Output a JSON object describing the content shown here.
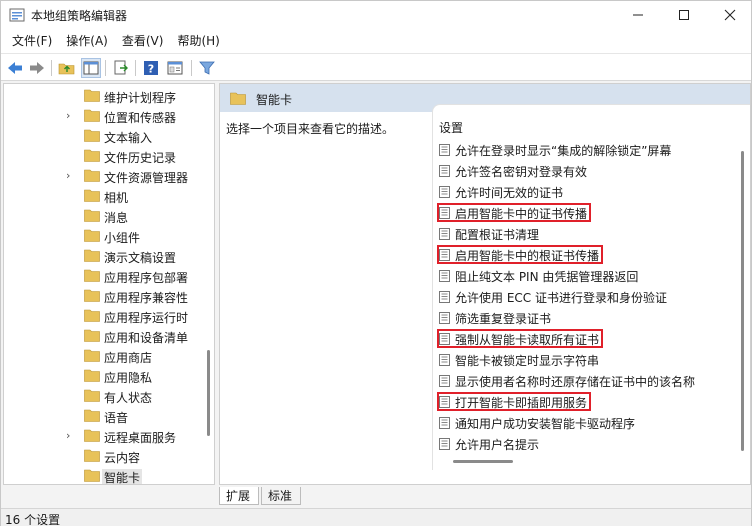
{
  "window": {
    "title": "本地组策略编辑器"
  },
  "menu": [
    "文件(F)",
    "操作(A)",
    "查看(V)",
    "帮助(H)"
  ],
  "tree": {
    "items": [
      {
        "label": "维护计划程序",
        "expandable": false,
        "selected": false
      },
      {
        "label": "位置和传感器",
        "expandable": true,
        "selected": false
      },
      {
        "label": "文本输入",
        "expandable": false,
        "selected": false
      },
      {
        "label": "文件历史记录",
        "expandable": false,
        "selected": false
      },
      {
        "label": "文件资源管理器",
        "expandable": true,
        "selected": false
      },
      {
        "label": "相机",
        "expandable": false,
        "selected": false
      },
      {
        "label": "消息",
        "expandable": false,
        "selected": false
      },
      {
        "label": "小组件",
        "expandable": false,
        "selected": false
      },
      {
        "label": "演示文稿设置",
        "expandable": false,
        "selected": false
      },
      {
        "label": "应用程序包部署",
        "expandable": false,
        "selected": false
      },
      {
        "label": "应用程序兼容性",
        "expandable": false,
        "selected": false
      },
      {
        "label": "应用程序运行时",
        "expandable": false,
        "selected": false
      },
      {
        "label": "应用和设备清单",
        "expandable": false,
        "selected": false
      },
      {
        "label": "应用商店",
        "expandable": false,
        "selected": false
      },
      {
        "label": "应用隐私",
        "expandable": false,
        "selected": false
      },
      {
        "label": "有人状态",
        "expandable": false,
        "selected": false
      },
      {
        "label": "语音",
        "expandable": false,
        "selected": false
      },
      {
        "label": "远程桌面服务",
        "expandable": true,
        "selected": false
      },
      {
        "label": "云内容",
        "expandable": false,
        "selected": false
      },
      {
        "label": "智能卡",
        "expandable": false,
        "selected": true
      }
    ]
  },
  "right": {
    "header_title": "智能卡",
    "description": "选择一个项目来查看它的描述。",
    "column_header": "设置",
    "settings": [
      {
        "label": "允许在登录时显示“集成的解除锁定”屏幕",
        "highlighted": false
      },
      {
        "label": "允许签名密钥对登录有效",
        "highlighted": false
      },
      {
        "label": "允许时间无效的证书",
        "highlighted": false
      },
      {
        "label": "启用智能卡中的证书传播",
        "highlighted": true
      },
      {
        "label": "配置根证书清理",
        "highlighted": false
      },
      {
        "label": "启用智能卡中的根证书传播",
        "highlighted": true
      },
      {
        "label": "阻止纯文本 PIN 由凭据管理器返回",
        "highlighted": false
      },
      {
        "label": "允许使用 ECC 证书进行登录和身份验证",
        "highlighted": false
      },
      {
        "label": "筛选重复登录证书",
        "highlighted": false
      },
      {
        "label": "强制从智能卡读取所有证书",
        "highlighted": true
      },
      {
        "label": "智能卡被锁定时显示字符串",
        "highlighted": false
      },
      {
        "label": "显示使用者名称时还原存储在证书中的该名称",
        "highlighted": false
      },
      {
        "label": "打开智能卡即插即用服务",
        "highlighted": true
      },
      {
        "label": "通知用户成功安装智能卡驱动程序",
        "highlighted": false
      },
      {
        "label": "允许用户名提示",
        "highlighted": false
      }
    ]
  },
  "tabs": [
    "扩展",
    "标准"
  ],
  "status": {
    "text": "16 个设置"
  },
  "colors": {
    "highlight": "#e0202a",
    "header_bg": "#d6e1ee",
    "folder": "#e8c25a"
  }
}
